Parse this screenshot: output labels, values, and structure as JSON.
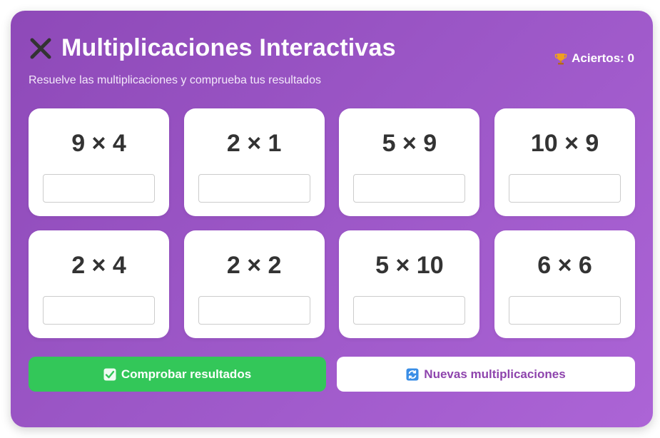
{
  "header": {
    "title": "Multiplicaciones Interactivas",
    "title_icon": "close-x-icon",
    "subtitle": "Resuelve las multiplicaciones y comprueba tus resultados"
  },
  "score": {
    "icon": "trophy-icon",
    "label": "Aciertos: 0"
  },
  "problems": [
    {
      "expression": "9 × 4",
      "answer": ""
    },
    {
      "expression": "2 × 1",
      "answer": ""
    },
    {
      "expression": "5 × 9",
      "answer": ""
    },
    {
      "expression": "10 × 9",
      "answer": ""
    },
    {
      "expression": "2 × 4",
      "answer": ""
    },
    {
      "expression": "2 × 2",
      "answer": ""
    },
    {
      "expression": "5 × 10",
      "answer": ""
    },
    {
      "expression": "6 × 6",
      "answer": ""
    }
  ],
  "actions": {
    "check_label": "Comprobar resultados",
    "check_icon": "check-mark-icon",
    "new_label": "Nuevas multiplicaciones",
    "new_icon": "refresh-icon"
  },
  "colors": {
    "panel_gradient_start": "#8e49b8",
    "panel_gradient_end": "#ac64d6",
    "check_button": "#33c759",
    "new_button_text": "#8e44ad",
    "problem_text": "#333333"
  }
}
